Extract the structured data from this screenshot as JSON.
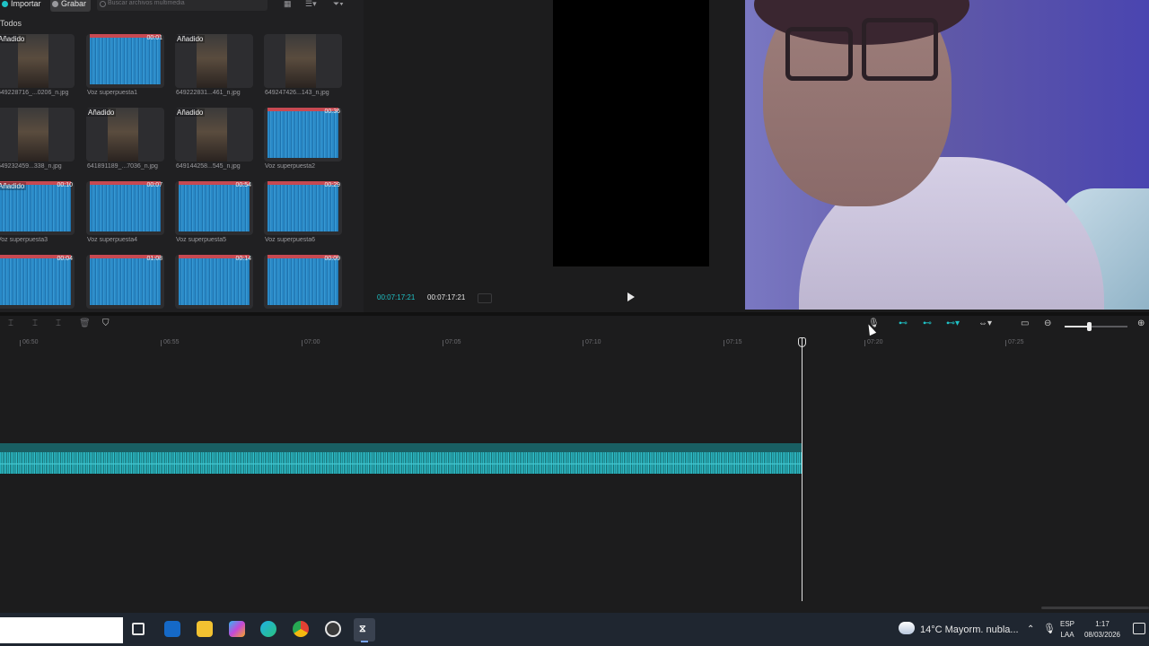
{
  "media": {
    "import_label": "Importar",
    "record_label": "Grabar",
    "search_placeholder": "Buscar archivos multimedia",
    "filter_label": "Todos",
    "items": [
      {
        "caption": "649228716_...0206_n.jpg",
        "added": "Añadido",
        "duration": "",
        "kind": "photo"
      },
      {
        "caption": "Voz superpuesta1",
        "added": "",
        "duration": "00:01",
        "kind": "audio"
      },
      {
        "caption": "649222831...461_n.jpg",
        "added": "Añadido",
        "duration": "",
        "kind": "photo"
      },
      {
        "caption": "649247426...143_n.jpg",
        "added": "",
        "duration": "",
        "kind": "photo"
      },
      {
        "caption": "649232459...338_n.jpg",
        "added": "",
        "duration": "",
        "kind": "photo"
      },
      {
        "caption": "641891189_...7036_n.jpg",
        "added": "Añadido",
        "duration": "",
        "kind": "photo"
      },
      {
        "caption": "649144258...545_n.jpg",
        "added": "Añadido",
        "duration": "",
        "kind": "photo"
      },
      {
        "caption": "Voz superpuesta2",
        "added": "",
        "duration": "00:36",
        "kind": "audio"
      },
      {
        "caption": "Voz superpuesta3",
        "added": "Añadido",
        "duration": "00:10",
        "kind": "audio"
      },
      {
        "caption": "Voz superpuesta4",
        "added": "",
        "duration": "00:07",
        "kind": "audio"
      },
      {
        "caption": "Voz superpuesta5",
        "added": "",
        "duration": "00:54",
        "kind": "audio"
      },
      {
        "caption": "Voz superpuesta6",
        "added": "",
        "duration": "00:29",
        "kind": "audio"
      },
      {
        "caption": "",
        "added": "",
        "duration": "00:04",
        "kind": "audio"
      },
      {
        "caption": "",
        "added": "",
        "duration": "01:08",
        "kind": "audio"
      },
      {
        "caption": "",
        "added": "",
        "duration": "00:14",
        "kind": "audio"
      },
      {
        "caption": "",
        "added": "",
        "duration": "00:09",
        "kind": "audio"
      }
    ]
  },
  "player": {
    "current_time": "00:07:17:21",
    "total_time": "00:07:17:21"
  },
  "timeline": {
    "ruler_ticks": [
      "06:50",
      "06:55",
      "07:00",
      "07:05",
      "07:10",
      "07:15",
      "07:20",
      "07:25"
    ],
    "zoom_level": 0.38
  },
  "taskbar": {
    "weather": "14°C  Mayorm. nubla...",
    "lang_line1": "ESP",
    "lang_line2": "LAA",
    "time": "1:17",
    "date": "08/03/2026"
  }
}
